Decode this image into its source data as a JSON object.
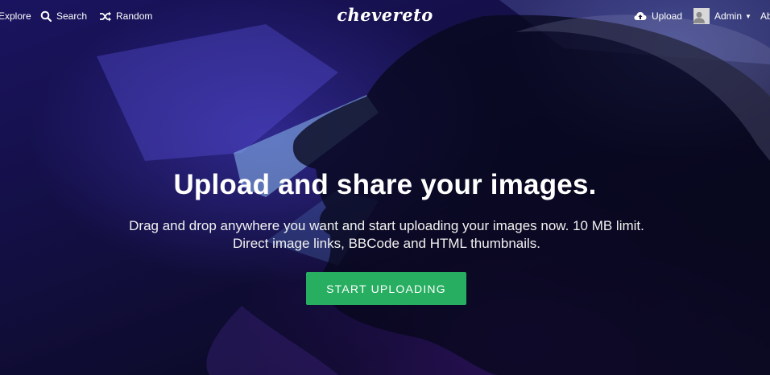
{
  "nav": {
    "explore_label": "Explore",
    "search_label": "Search",
    "random_label": "Random",
    "logo_text": "chevereto",
    "upload_label": "Upload",
    "user_label": "Admin",
    "overflow_label": "Ab"
  },
  "hero": {
    "title": "Upload and share your images.",
    "description": "Drag and drop anywhere you want and start uploading your images now. 10 MB limit. Direct image links, BBCode and HTML thumbnails.",
    "cta_label": "START UPLOADING"
  },
  "colors": {
    "cta_background": "#27ae60",
    "text": "#ffffff"
  },
  "icons": {
    "search": "search-icon",
    "random": "shuffle-icon",
    "upload": "cloud-upload-icon",
    "avatar": "user-avatar-icon",
    "dropdown": "caret-down-icon"
  }
}
